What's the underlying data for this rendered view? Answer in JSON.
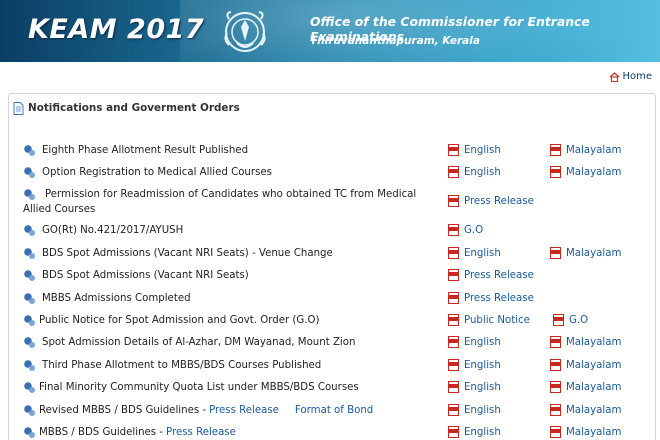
{
  "header": {
    "logo": "KEAM 2017",
    "office_title": "Office of the Commissioner for Entrance Examinations",
    "office_location": "Thiruvananthapuram, Kerala"
  },
  "nav": {
    "home": "Home"
  },
  "section": {
    "title": "Notifications and Goverment Orders"
  },
  "notices": [
    {
      "text": "Eighth Phase Allotment Result Published",
      "links": [
        "English",
        "Malayalam"
      ]
    },
    {
      "text": "Option Registration to Medical Allied Courses",
      "links": [
        "English",
        "Malayalam"
      ]
    },
    {
      "text": "Permission for Readmission of Candidates who obtained TC from Medical Allied Courses",
      "links": [
        "Press Release"
      ]
    },
    {
      "text": "GO(Rt) No.421/2017/AYUSH",
      "links": [
        "G.O"
      ]
    },
    {
      "text": "BDS Spot Admissions (Vacant NRI Seats) - Venue Change",
      "links": [
        "English",
        "Malayalam"
      ]
    },
    {
      "text": "BDS Spot Admissions (Vacant NRI Seats)",
      "links": [
        "Press Release"
      ]
    },
    {
      "text": "MBBS Admissions Completed",
      "links": [
        "Press Release"
      ]
    },
    {
      "text": "Public Notice for Spot Admission and Govt. Order (G.O)",
      "links": [
        "Public Notice",
        "G.O"
      ]
    },
    {
      "text": "Spot Admission Details of Al-Azhar, DM Wayanad, Mount Zion",
      "links": [
        "English",
        "Malayalam"
      ]
    },
    {
      "text": "Third Phase Allotment to MBBS/BDS Courses Published",
      "links": [
        "English",
        "Malayalam"
      ]
    },
    {
      "text": "Final Minority Community Quota List under MBBS/BDS Courses",
      "links": [
        "English",
        "Malayalam"
      ]
    },
    {
      "text": "Revised MBBS / BDS Guidelines -",
      "inline_links": [
        "Press Release",
        "Format of Bond"
      ],
      "links": [
        "English",
        "Malayalam"
      ]
    },
    {
      "text": "MBBS / BDS Guidelines -",
      "inline_links": [
        "Press Release"
      ],
      "links": [
        "English",
        "Malayalam"
      ]
    }
  ],
  "colors": {
    "banner_dark": "#0b3e63",
    "banner_light": "#56bfe0",
    "link": "#1a5a9a",
    "pdf_red": "#c8281e"
  }
}
